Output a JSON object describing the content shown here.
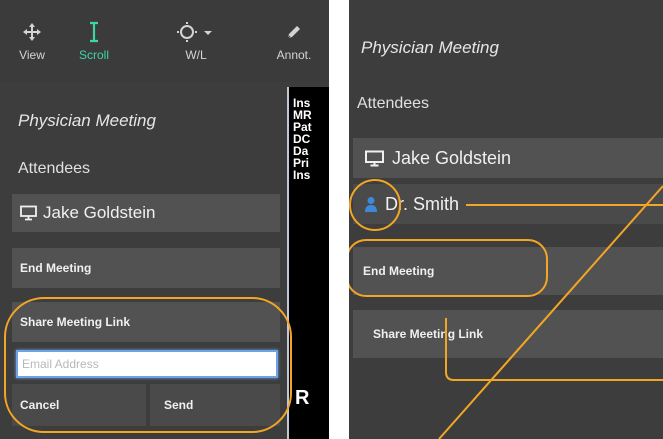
{
  "toolbar": {
    "view_label": "View",
    "scroll_label": "Scroll",
    "wl_label": "W/L",
    "annot_label": "Annot."
  },
  "left": {
    "title": "Physician Meeting",
    "attendees_heading": "Attendees",
    "attendee": "Jake Goldstein",
    "end_meeting": "End Meeting",
    "share_link": "Share Meeting Link",
    "email_placeholder": "Email Address",
    "cancel": "Cancel",
    "send": "Send"
  },
  "viewer": {
    "lines": [
      "Ins",
      "MR",
      "Pat",
      "DC",
      "Da",
      "Pri",
      "Ins"
    ],
    "letter": "R"
  },
  "right": {
    "title": "Physician Meeting",
    "attendees_heading": "Attendees",
    "attendee_1": "Jake Goldstein",
    "attendee_2": "Dr. Smith",
    "end_meeting": "End Meeting",
    "share_link": "Share Meeting Link"
  },
  "colors": {
    "accent_scroll": "#3ed4a8",
    "highlight_ring": "#f3a623",
    "input_focus": "#6fa3e6",
    "user_icon": "#3f88d9"
  }
}
